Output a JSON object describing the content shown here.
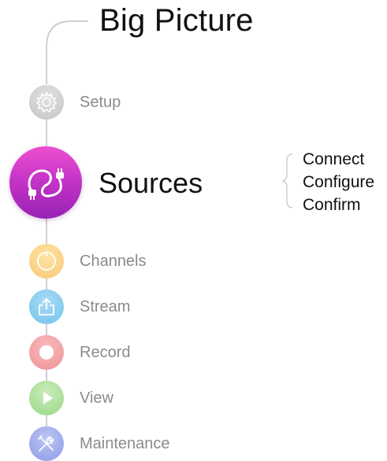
{
  "title": "Big Picture",
  "steps": [
    {
      "label": "Setup",
      "icon": "gear-icon",
      "state": "inactive"
    },
    {
      "label": "Sources",
      "icon": "plug-cable-icon",
      "state": "active"
    },
    {
      "label": "Channels",
      "icon": "circle-ring-icon",
      "state": "inactive"
    },
    {
      "label": "Stream",
      "icon": "share-upload-icon",
      "state": "inactive"
    },
    {
      "label": "Record",
      "icon": "record-dot-icon",
      "state": "inactive"
    },
    {
      "label": "View",
      "icon": "play-icon",
      "state": "inactive"
    },
    {
      "label": "Maintenance",
      "icon": "tools-icon",
      "state": "inactive"
    }
  ],
  "active_substeps": [
    "Connect",
    "Configure",
    "Confirm"
  ],
  "colors": {
    "setup": "#cfcfcf",
    "sources_top": "#e646c9",
    "sources_bottom": "#9b22b8",
    "channels": "#fbd48a",
    "stream": "#8fd0f2",
    "record": "#f3a9ad",
    "view": "#b3e3a2",
    "maintenance": "#a9b4ee",
    "line": "#cfcfcf"
  }
}
